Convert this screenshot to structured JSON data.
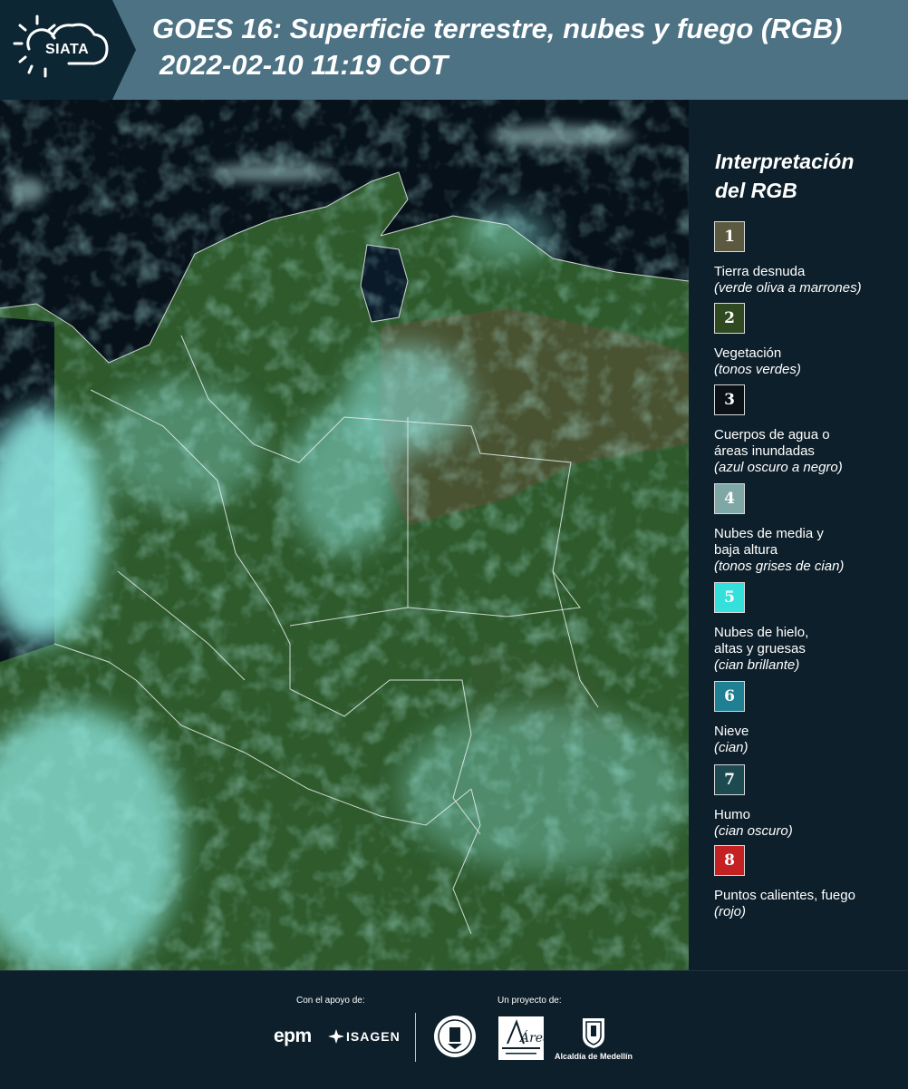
{
  "header": {
    "logo_text": "SIATA",
    "title_line1": "GOES 16: Superficie terrestre, nubes y fuego (RGB)",
    "title_line2": "2022-02-10 11:19 COT"
  },
  "legend": {
    "title_line1": "Interpretación",
    "title_line2": "del RGB",
    "items": [
      {
        "number": "1",
        "color": "#5b5a40",
        "label_lines": [
          "Tierra desnuda"
        ],
        "sub": "(verde oliva a marrones)"
      },
      {
        "number": "2",
        "color": "#2f4a20",
        "label_lines": [
          "Vegetación"
        ],
        "sub": "(tonos verdes)"
      },
      {
        "number": "3",
        "color": "#0a1218",
        "label_lines": [
          "Cuerpos de agua o",
          "áreas inundadas"
        ],
        "sub": "(azul oscuro a negro)"
      },
      {
        "number": "4",
        "color": "#7fa7a5",
        "label_lines": [
          "Nubes de media y",
          "baja altura"
        ],
        "sub": "(tonos grises de cian)"
      },
      {
        "number": "5",
        "color": "#33e0dc",
        "label_lines": [
          "Nubes de hielo,",
          "altas y gruesas"
        ],
        "sub": "(cian brillante)"
      },
      {
        "number": "6",
        "color": "#1f7f93",
        "label_lines": [
          "Nieve"
        ],
        "sub": "(cian)"
      },
      {
        "number": "7",
        "color": "#1d4a50",
        "label_lines": [
          "Humo"
        ],
        "sub": "(cian oscuro)"
      },
      {
        "number": "8",
        "color": "#c42222",
        "label_lines": [
          "Puntos calientes, fuego"
        ],
        "sub": "(rojo)"
      }
    ]
  },
  "footer": {
    "support_label": "Con el apoyo de:",
    "project_label": "Un proyecto de:",
    "sponsors": [
      "epm",
      "ISAGEN"
    ],
    "partners": [
      "Área Metropolitana Valle de Aburrá",
      "Alcaldía de Medellín"
    ],
    "medellin_label": "Alcaldía de Medellín",
    "area_text": "Área"
  },
  "colors": {
    "header_bg": "#4d7284",
    "panel_bg": "#0d1f2a",
    "vegetation": "#2f5a2c",
    "clouds": "#7fe3df",
    "water": "#07111a"
  }
}
